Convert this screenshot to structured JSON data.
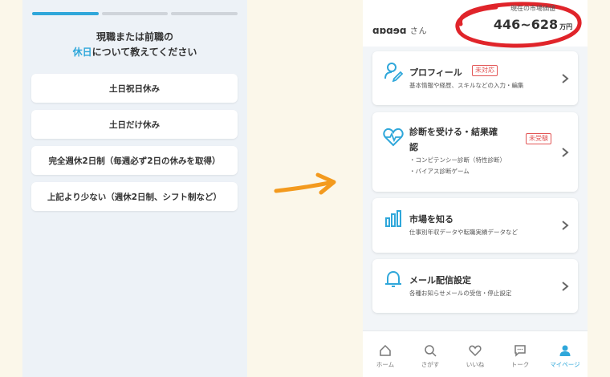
{
  "left": {
    "question_line1": "現職または前職の",
    "question_highlight": "休日",
    "question_line2_rest": "について教えてください",
    "options": [
      "土日祝日休み",
      "土日だけ休み",
      "完全週休2日制（毎週必ず2日の休みを取得）",
      "上記より少ない（週休2日制、シフト制など）"
    ]
  },
  "right": {
    "user_name": "ɑɒɑɘɑ",
    "user_suffix": "さん",
    "market_value_label": "現在の市場価値",
    "market_value": "446~628",
    "market_value_unit": "万円",
    "cards": [
      {
        "title": "プロフィール",
        "badge": "未対応",
        "desc": [
          "基本情報や経歴、スキルなどの入力・編集"
        ]
      },
      {
        "title_line1": "診断を受ける・結果確",
        "title_line2": "認",
        "badge": "未受験",
        "desc": [
          "・コンピテンシー診断（特性診断）",
          "・バイアス診断ゲーム"
        ]
      },
      {
        "title": "市場を知る",
        "desc": [
          "仕事別年収データや転職実績データなど"
        ]
      },
      {
        "title": "メール配信設定",
        "desc": [
          "各種お知らせメールの受信・停止設定"
        ]
      }
    ],
    "tabs": [
      "ホーム",
      "さがす",
      "いいね",
      "トーク",
      "マイページ"
    ]
  },
  "colors": {
    "accent": "#2fa7da",
    "badge_red": "#e25555",
    "arrow": "#f39a1e",
    "circle": "#e0242a"
  }
}
